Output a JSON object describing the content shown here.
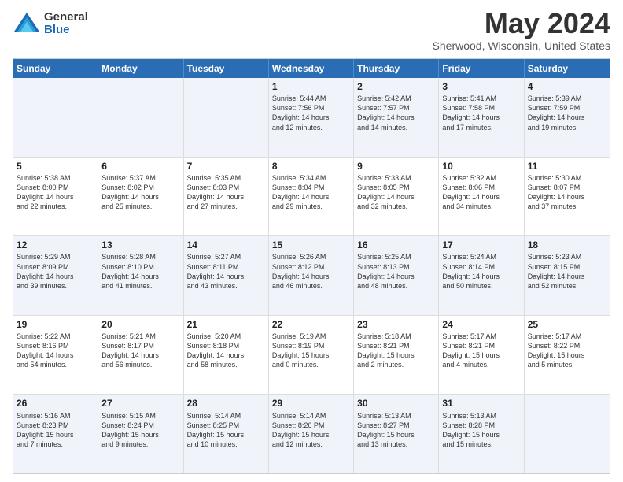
{
  "logo": {
    "general": "General",
    "blue": "Blue"
  },
  "title": "May 2024",
  "location": "Sherwood, Wisconsin, United States",
  "days_of_week": [
    "Sunday",
    "Monday",
    "Tuesday",
    "Wednesday",
    "Thursday",
    "Friday",
    "Saturday"
  ],
  "weeks": [
    [
      {
        "day": "",
        "text": ""
      },
      {
        "day": "",
        "text": ""
      },
      {
        "day": "",
        "text": ""
      },
      {
        "day": "1",
        "text": "Sunrise: 5:44 AM\nSunset: 7:56 PM\nDaylight: 14 hours\nand 12 minutes."
      },
      {
        "day": "2",
        "text": "Sunrise: 5:42 AM\nSunset: 7:57 PM\nDaylight: 14 hours\nand 14 minutes."
      },
      {
        "day": "3",
        "text": "Sunrise: 5:41 AM\nSunset: 7:58 PM\nDaylight: 14 hours\nand 17 minutes."
      },
      {
        "day": "4",
        "text": "Sunrise: 5:39 AM\nSunset: 7:59 PM\nDaylight: 14 hours\nand 19 minutes."
      }
    ],
    [
      {
        "day": "5",
        "text": "Sunrise: 5:38 AM\nSunset: 8:00 PM\nDaylight: 14 hours\nand 22 minutes."
      },
      {
        "day": "6",
        "text": "Sunrise: 5:37 AM\nSunset: 8:02 PM\nDaylight: 14 hours\nand 25 minutes."
      },
      {
        "day": "7",
        "text": "Sunrise: 5:35 AM\nSunset: 8:03 PM\nDaylight: 14 hours\nand 27 minutes."
      },
      {
        "day": "8",
        "text": "Sunrise: 5:34 AM\nSunset: 8:04 PM\nDaylight: 14 hours\nand 29 minutes."
      },
      {
        "day": "9",
        "text": "Sunrise: 5:33 AM\nSunset: 8:05 PM\nDaylight: 14 hours\nand 32 minutes."
      },
      {
        "day": "10",
        "text": "Sunrise: 5:32 AM\nSunset: 8:06 PM\nDaylight: 14 hours\nand 34 minutes."
      },
      {
        "day": "11",
        "text": "Sunrise: 5:30 AM\nSunset: 8:07 PM\nDaylight: 14 hours\nand 37 minutes."
      }
    ],
    [
      {
        "day": "12",
        "text": "Sunrise: 5:29 AM\nSunset: 8:09 PM\nDaylight: 14 hours\nand 39 minutes."
      },
      {
        "day": "13",
        "text": "Sunrise: 5:28 AM\nSunset: 8:10 PM\nDaylight: 14 hours\nand 41 minutes."
      },
      {
        "day": "14",
        "text": "Sunrise: 5:27 AM\nSunset: 8:11 PM\nDaylight: 14 hours\nand 43 minutes."
      },
      {
        "day": "15",
        "text": "Sunrise: 5:26 AM\nSunset: 8:12 PM\nDaylight: 14 hours\nand 46 minutes."
      },
      {
        "day": "16",
        "text": "Sunrise: 5:25 AM\nSunset: 8:13 PM\nDaylight: 14 hours\nand 48 minutes."
      },
      {
        "day": "17",
        "text": "Sunrise: 5:24 AM\nSunset: 8:14 PM\nDaylight: 14 hours\nand 50 minutes."
      },
      {
        "day": "18",
        "text": "Sunrise: 5:23 AM\nSunset: 8:15 PM\nDaylight: 14 hours\nand 52 minutes."
      }
    ],
    [
      {
        "day": "19",
        "text": "Sunrise: 5:22 AM\nSunset: 8:16 PM\nDaylight: 14 hours\nand 54 minutes."
      },
      {
        "day": "20",
        "text": "Sunrise: 5:21 AM\nSunset: 8:17 PM\nDaylight: 14 hours\nand 56 minutes."
      },
      {
        "day": "21",
        "text": "Sunrise: 5:20 AM\nSunset: 8:18 PM\nDaylight: 14 hours\nand 58 minutes."
      },
      {
        "day": "22",
        "text": "Sunrise: 5:19 AM\nSunset: 8:19 PM\nDaylight: 15 hours\nand 0 minutes."
      },
      {
        "day": "23",
        "text": "Sunrise: 5:18 AM\nSunset: 8:21 PM\nDaylight: 15 hours\nand 2 minutes."
      },
      {
        "day": "24",
        "text": "Sunrise: 5:17 AM\nSunset: 8:21 PM\nDaylight: 15 hours\nand 4 minutes."
      },
      {
        "day": "25",
        "text": "Sunrise: 5:17 AM\nSunset: 8:22 PM\nDaylight: 15 hours\nand 5 minutes."
      }
    ],
    [
      {
        "day": "26",
        "text": "Sunrise: 5:16 AM\nSunset: 8:23 PM\nDaylight: 15 hours\nand 7 minutes."
      },
      {
        "day": "27",
        "text": "Sunrise: 5:15 AM\nSunset: 8:24 PM\nDaylight: 15 hours\nand 9 minutes."
      },
      {
        "day": "28",
        "text": "Sunrise: 5:14 AM\nSunset: 8:25 PM\nDaylight: 15 hours\nand 10 minutes."
      },
      {
        "day": "29",
        "text": "Sunrise: 5:14 AM\nSunset: 8:26 PM\nDaylight: 15 hours\nand 12 minutes."
      },
      {
        "day": "30",
        "text": "Sunrise: 5:13 AM\nSunset: 8:27 PM\nDaylight: 15 hours\nand 13 minutes."
      },
      {
        "day": "31",
        "text": "Sunrise: 5:13 AM\nSunset: 8:28 PM\nDaylight: 15 hours\nand 15 minutes."
      },
      {
        "day": "",
        "text": ""
      }
    ]
  ],
  "alt_rows": [
    0,
    2,
    4
  ]
}
